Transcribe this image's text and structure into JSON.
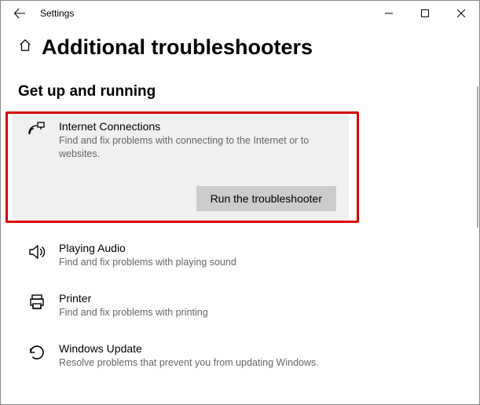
{
  "window": {
    "title": "Settings"
  },
  "page": {
    "heading": "Additional troubleshooters",
    "section": "Get up and running"
  },
  "items": {
    "internet": {
      "title": "Internet Connections",
      "desc": "Find and fix problems with connecting to the Internet or to websites.",
      "button": "Run the troubleshooter"
    },
    "audio": {
      "title": "Playing Audio",
      "desc": "Find and fix problems with playing sound"
    },
    "printer": {
      "title": "Printer",
      "desc": "Find and fix problems with printing"
    },
    "update": {
      "title": "Windows Update",
      "desc": "Resolve problems that prevent you from updating Windows."
    }
  }
}
